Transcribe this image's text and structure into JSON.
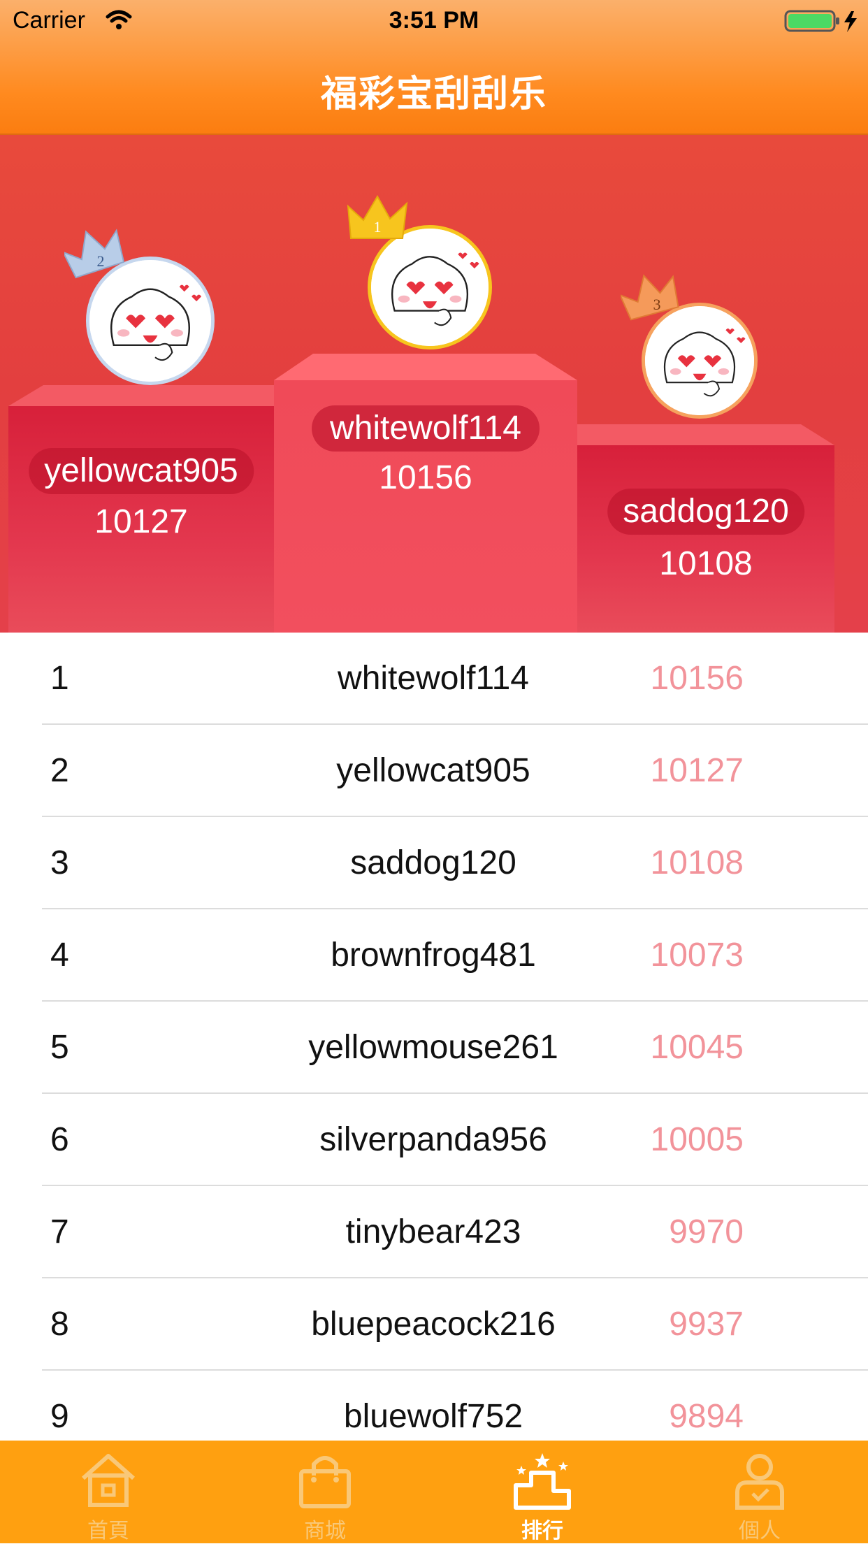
{
  "status_bar": {
    "carrier": "Carrier",
    "time": "3:51 PM"
  },
  "nav": {
    "title": "福彩宝刮刮乐"
  },
  "podium": {
    "first": {
      "rank": "1",
      "name": "whitewolf114",
      "score": "10156"
    },
    "second": {
      "rank": "2",
      "name": "yellowcat905",
      "score": "10127"
    },
    "third": {
      "rank": "3",
      "name": "saddog120",
      "score": "10108"
    }
  },
  "ranking": [
    {
      "rank": "1",
      "name": "whitewolf114",
      "score": "10156"
    },
    {
      "rank": "2",
      "name": "yellowcat905",
      "score": "10127"
    },
    {
      "rank": "3",
      "name": "saddog120",
      "score": "10108"
    },
    {
      "rank": "4",
      "name": "brownfrog481",
      "score": "10073"
    },
    {
      "rank": "5",
      "name": "yellowmouse261",
      "score": "10045"
    },
    {
      "rank": "6",
      "name": "silverpanda956",
      "score": "10005"
    },
    {
      "rank": "7",
      "name": "tinybear423",
      "score": "9970"
    },
    {
      "rank": "8",
      "name": "bluepeacock216",
      "score": "9937"
    },
    {
      "rank": "9",
      "name": "bluewolf752",
      "score": "9894"
    }
  ],
  "tabbar": {
    "tabs": [
      {
        "label": "首頁",
        "icon": "home-icon",
        "active": false
      },
      {
        "label": "商城",
        "icon": "shop-bag-icon",
        "active": false
      },
      {
        "label": "排行",
        "icon": "ranking-podium-icon",
        "active": true
      },
      {
        "label": "個人",
        "icon": "person-icon",
        "active": false
      }
    ]
  },
  "colors": {
    "header_orange": "#ff8a1f",
    "podium_red": "#e4404a",
    "score_pink": "#f2939a",
    "tabbar_orange": "#ffa010",
    "crown_gold": "#f7c51e",
    "crown_silver": "#b8cde8",
    "crown_bronze": "#f59a5a"
  }
}
